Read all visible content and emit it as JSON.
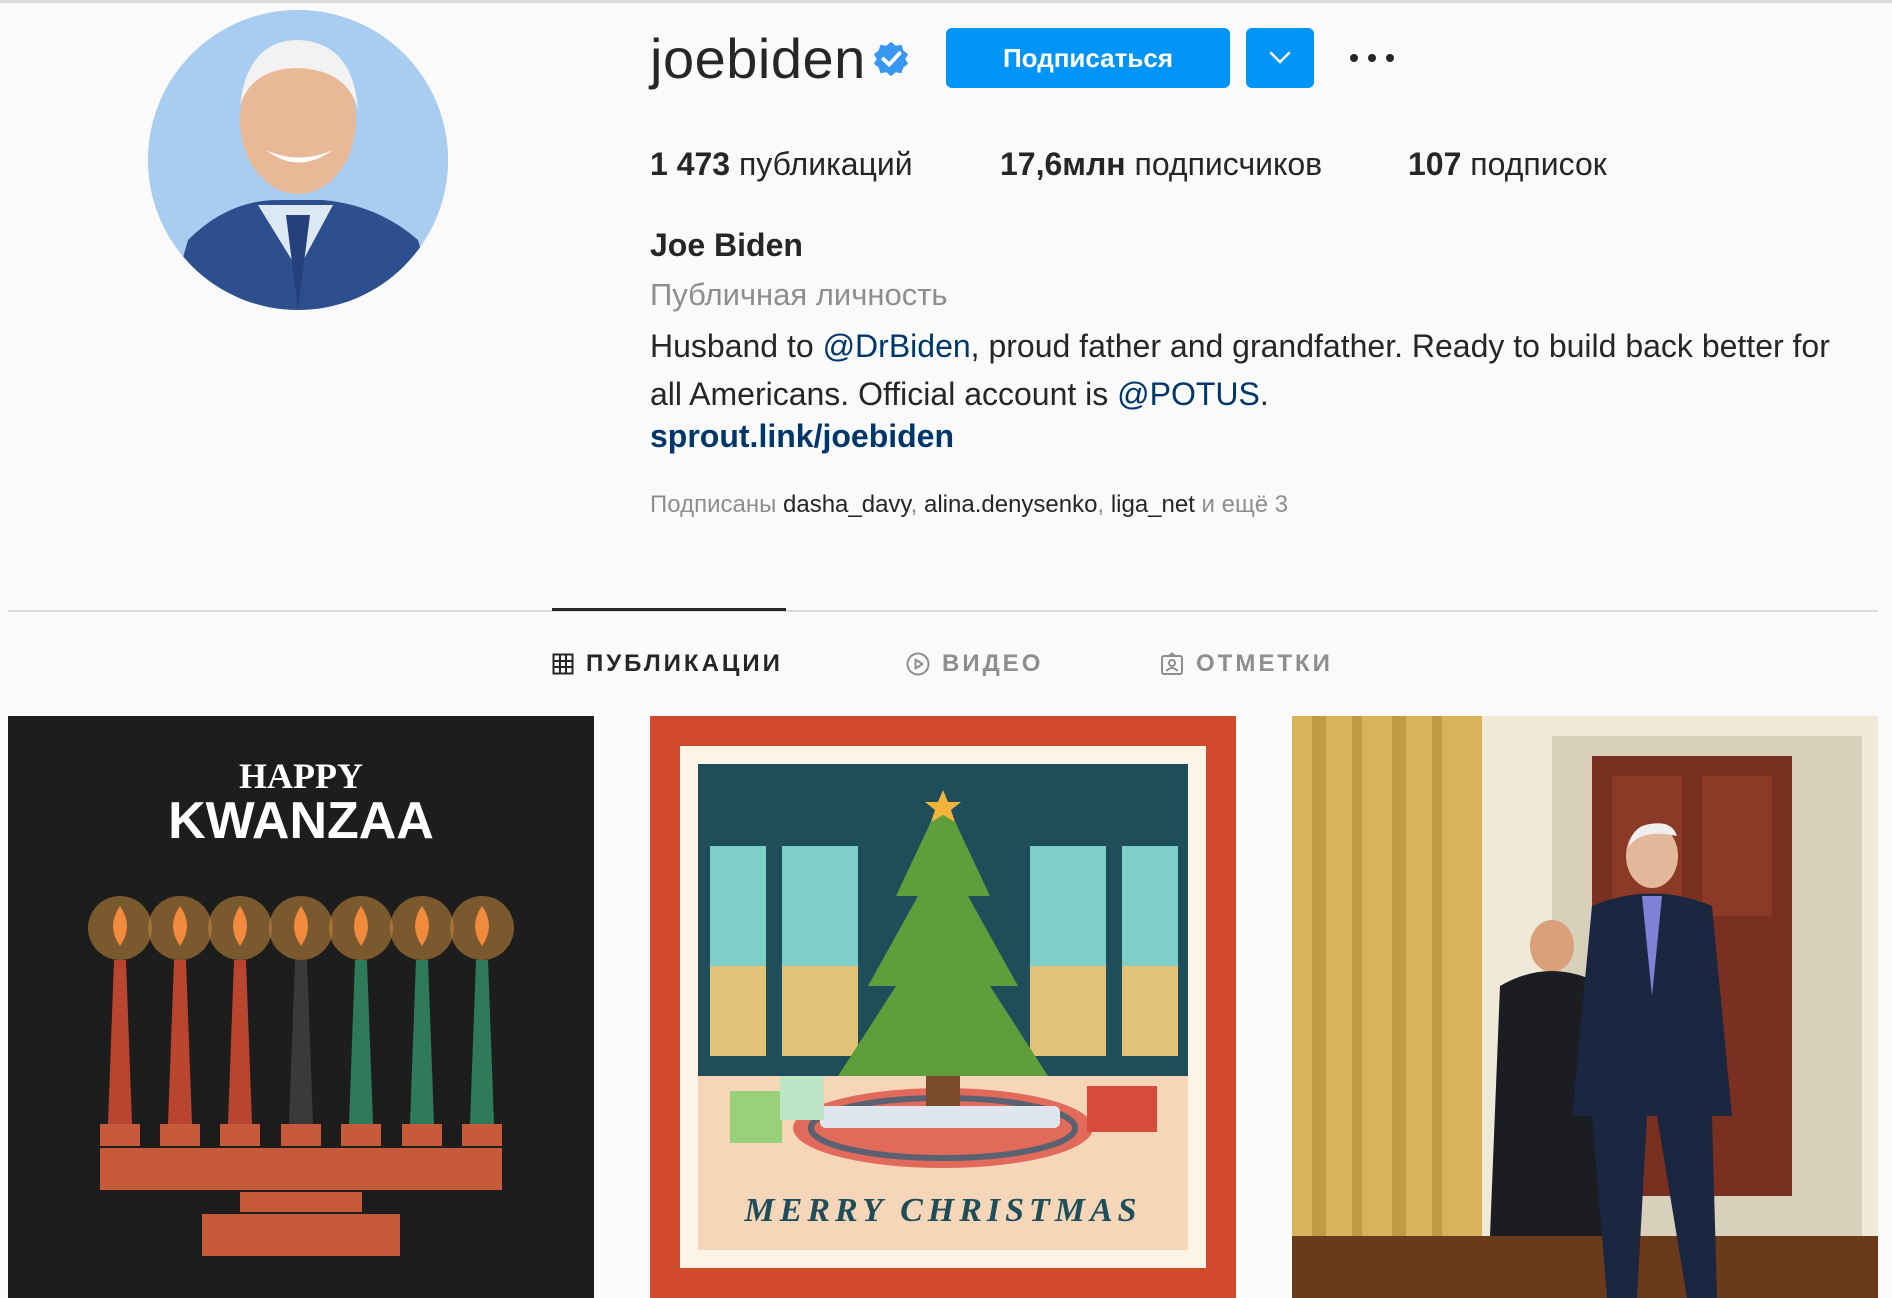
{
  "profile": {
    "username": "joebiden",
    "follow_label": "Подписаться",
    "stats": {
      "posts_count": "1 473",
      "posts_label": " публикаций",
      "followers_count": "17,6млн",
      "followers_label": " подписчиков",
      "following_count": "107",
      "following_label": " подписок"
    },
    "full_name": "Joe Biden",
    "category": "Публичная личность",
    "bio": {
      "part1": "Husband to ",
      "mention1": "@DrBiden",
      "part2": ", proud father and grandfather. Ready to build back better for all Americans. Official account is ",
      "mention2": "@POTUS",
      "part3": "."
    },
    "link": "sprout.link/joebiden",
    "followed_by": {
      "prefix": "Подписаны ",
      "users": [
        "dasha_davy",
        "alina.denysenko",
        "liga_net"
      ],
      "sep": ", ",
      "suffix": " и ещё 3"
    }
  },
  "tabs": [
    {
      "label": "ПУБЛИКАЦИИ",
      "icon": "grid-icon",
      "active": true
    },
    {
      "label": "ВИДЕО",
      "icon": "play-icon",
      "active": false
    },
    {
      "label": "ОТМЕТКИ",
      "icon": "tagged-icon",
      "active": false
    }
  ],
  "posts": [
    {
      "line1": "HAPPY",
      "line2": "KWANZAA"
    },
    {
      "caption": "MERRY CHRISTMAS"
    },
    {
      "caption": ""
    }
  ],
  "colors": {
    "accent": "#0095f6",
    "link": "#00376b",
    "muted": "#8e8e8e"
  }
}
